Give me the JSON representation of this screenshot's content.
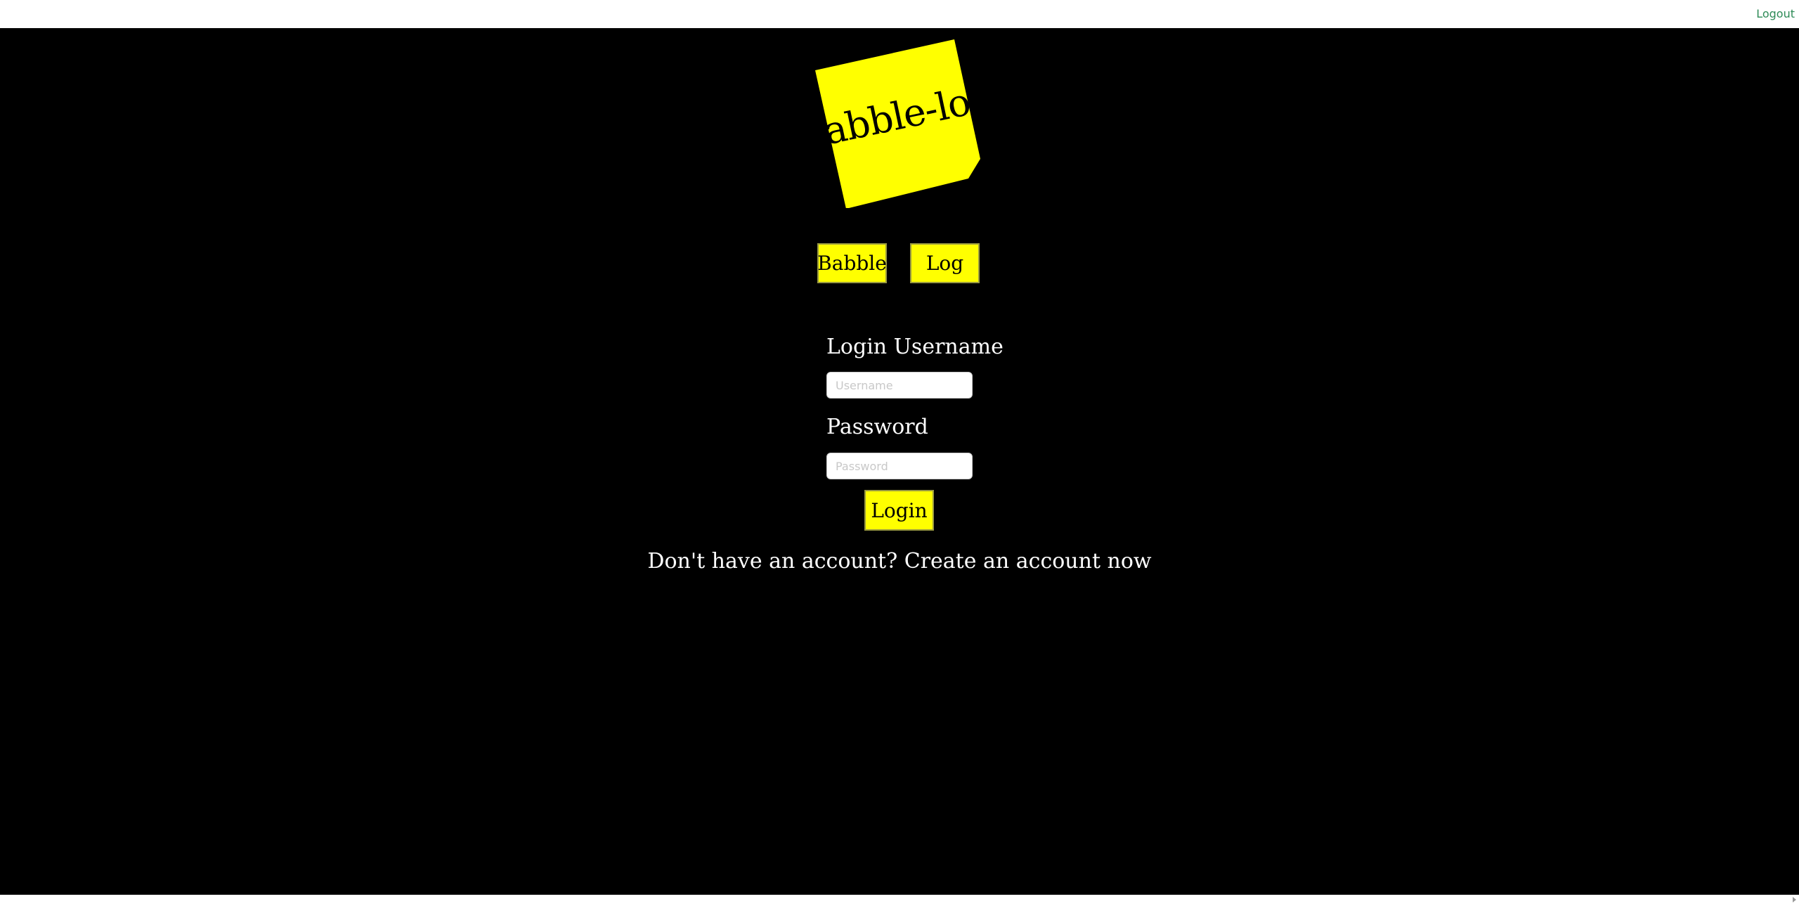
{
  "header": {
    "logout_label": "Logout"
  },
  "logo": {
    "text": "Babble-log",
    "note_color": "#ffff00"
  },
  "nav": {
    "babble_label": "Babble",
    "log_label": "Log"
  },
  "login_form": {
    "username_label": "Login Username",
    "username_placeholder": "Username",
    "username_value": "",
    "password_label": "Password",
    "password_placeholder": "Password",
    "password_value": "",
    "submit_label": "Login"
  },
  "signup": {
    "prompt": "Don't have an account?",
    "link_label": "Create an account now"
  },
  "colors": {
    "background": "#000000",
    "accent": "#ffff00",
    "text": "#ffffff",
    "logout_link": "#2e8b57"
  }
}
